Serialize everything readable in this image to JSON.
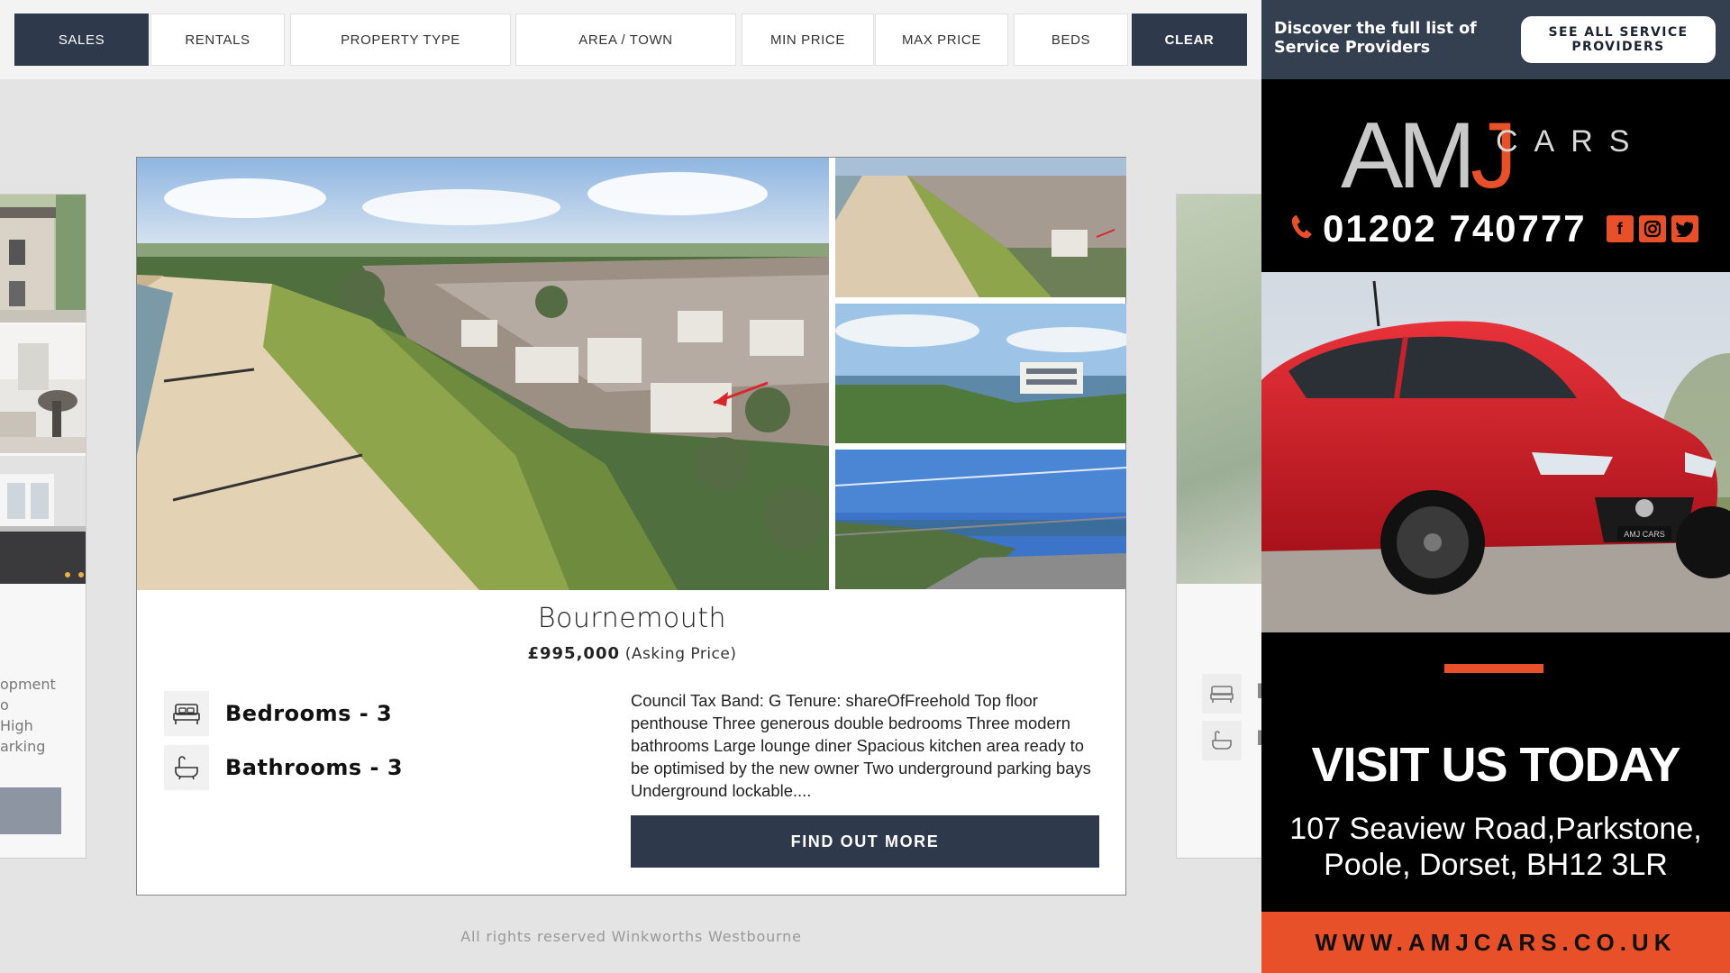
{
  "filters": {
    "sales": "SALES",
    "rentals": "RENTALS",
    "property_type": "PROPERTY TYPE",
    "area_town": "AREA / TOWN",
    "min_price": "MIN PRICE",
    "max_price": "MAX PRICE",
    "beds": "BEDS",
    "clear": "CLEAR"
  },
  "ghost_left": {
    "text_lines": [
      "opment",
      "o",
      "High",
      "arking"
    ]
  },
  "ghost_right": {
    "chars": [
      "B",
      "B"
    ]
  },
  "property": {
    "title": "Bournemouth",
    "price": "£995,000",
    "price_type": "(Asking Price)",
    "bedrooms": "Bedrooms - 3",
    "bathrooms": "Bathrooms - 3",
    "description": "Council Tax Band: G Tenure: shareOfFreehold Top floor penthouse Three generous double bedrooms Three modern bathrooms Large lounge diner Spacious kitchen area ready to be optimised by the new owner Two underground parking bays Underground lockable....",
    "cta": "FIND OUT MORE"
  },
  "footer": {
    "text": "All rights reserved Winkworths Westbourne"
  },
  "promo": {
    "text": "Discover the full list of Service Providers",
    "button": "SEE ALL SERVICE PROVIDERS"
  },
  "ad": {
    "brand_a": "AM",
    "brand_j": "J",
    "brand_cars": "CARS",
    "phone": "01202 740777",
    "social": [
      "facebook-icon",
      "instagram-icon",
      "twitter-icon"
    ],
    "plate_text": "AMJ CARS",
    "headline": "VISIT US TODAY",
    "address_line1": "107 Seaview Road,Parkstone,",
    "address_line2": "Poole, Dorset, BH12 3LR",
    "url": "WWW.AMJCARS.CO.UK",
    "accent_color": "#e8502a"
  },
  "colors": {
    "primary_dark": "#2e3a4b",
    "promo_bg": "#343f4f",
    "page_bg": "#e4e4e4"
  }
}
